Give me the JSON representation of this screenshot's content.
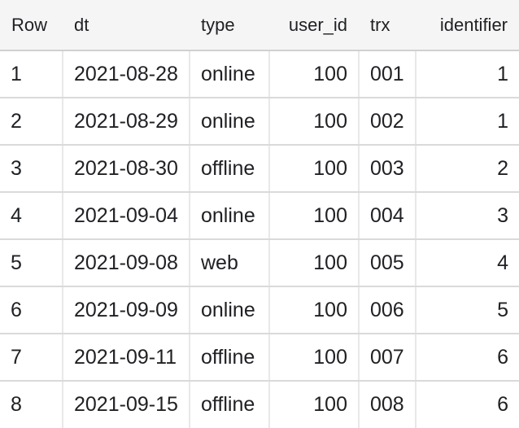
{
  "table": {
    "columns": [
      {
        "label": "Row",
        "align": "left"
      },
      {
        "label": "dt",
        "align": "left"
      },
      {
        "label": "type",
        "align": "left"
      },
      {
        "label": "user_id",
        "align": "right"
      },
      {
        "label": "trx",
        "align": "left"
      },
      {
        "label": "identifier",
        "align": "right"
      }
    ],
    "rows": [
      [
        "1",
        "2021-08-28",
        "online",
        "100",
        "001",
        "1"
      ],
      [
        "2",
        "2021-08-29",
        "online",
        "100",
        "002",
        "1"
      ],
      [
        "3",
        "2021-08-30",
        "offline",
        "100",
        "003",
        "2"
      ],
      [
        "4",
        "2021-09-04",
        "online",
        "100",
        "004",
        "3"
      ],
      [
        "5",
        "2021-09-08",
        "web",
        "100",
        "005",
        "4"
      ],
      [
        "6",
        "2021-09-09",
        "online",
        "100",
        "006",
        "5"
      ],
      [
        "7",
        "2021-09-11",
        "offline",
        "100",
        "007",
        "6"
      ],
      [
        "8",
        "2021-09-15",
        "offline",
        "100",
        "008",
        "6"
      ]
    ]
  }
}
